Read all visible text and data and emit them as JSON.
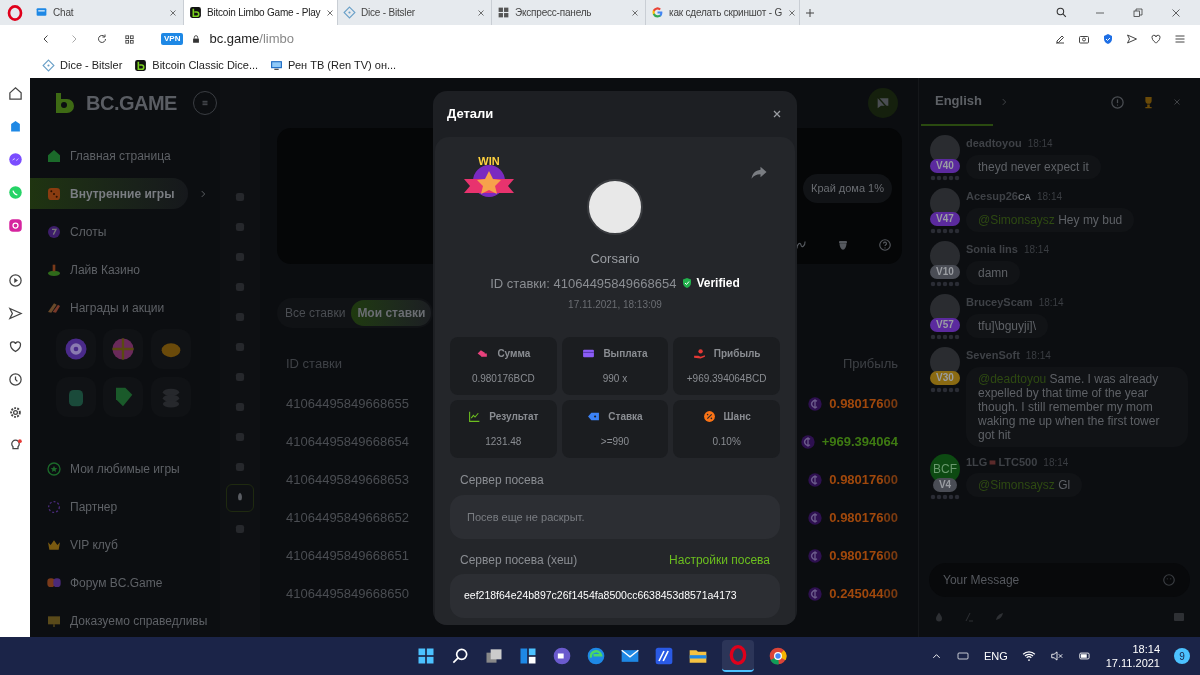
{
  "browser": {
    "tabs": [
      {
        "title": "Chat",
        "selected": false
      },
      {
        "title": "Bitcoin Limbo Game - Play",
        "selected": true
      },
      {
        "title": "Dice - Bitsler",
        "selected": false
      },
      {
        "title": "Экспресс-панель",
        "selected": false
      },
      {
        "title": "как сделать скриншот - G",
        "selected": false
      }
    ],
    "vpn": "VPN",
    "url_host": "bc.game",
    "url_path": "/limbo",
    "bookmarks": [
      {
        "title": "Dice - Bitsler"
      },
      {
        "title": "Bitcoin Classic Dice..."
      },
      {
        "title": "Рен ТВ (Ren TV) он..."
      }
    ]
  },
  "sidebar": {
    "logo": "BC.GAME",
    "sections": [
      {
        "items": [
          {
            "label": "Главная страница",
            "selected": false
          },
          {
            "label": "Внутренние игры",
            "selected": true
          },
          {
            "label": "Слоты",
            "selected": false
          },
          {
            "label": "Лайв Казино",
            "selected": false
          },
          {
            "label": "Награды и акции",
            "selected": false
          }
        ]
      },
      {
        "items": [
          {
            "label": "Мои любимые игры",
            "selected": false
          },
          {
            "label": "Партнер",
            "selected": false
          },
          {
            "label": "VIP клуб",
            "selected": false
          },
          {
            "label": "Форум BC.Game",
            "selected": false
          },
          {
            "label": "Доказуемо справедливы",
            "selected": false
          }
        ]
      }
    ]
  },
  "game": {
    "house_edge": "Край дома 1%"
  },
  "bets": {
    "tabs": [
      {
        "label": "Все ставки",
        "selected": false
      },
      {
        "label": "Мои ставки",
        "selected": true
      }
    ],
    "columns": [
      "ID ставки",
      "Прибыль"
    ],
    "rows": [
      {
        "id": "41064495849668655",
        "profit": "0.980176",
        "profit_tail": "00",
        "kind": "loss"
      },
      {
        "id": "41064495849668654",
        "profit": "+969.394064",
        "profit_tail": "",
        "kind": "win"
      },
      {
        "id": "41064495849668653",
        "profit": "0.980176",
        "profit_tail": "00",
        "kind": "loss"
      },
      {
        "id": "41064495849668652",
        "profit": "0.980176",
        "profit_tail": "00",
        "kind": "loss"
      },
      {
        "id": "41064495849668651",
        "profit": "0.980176",
        "profit_tail": "00",
        "kind": "loss"
      },
      {
        "id": "41064495849668650",
        "profit": "0.245044",
        "profit_tail": "00",
        "kind": "loss"
      }
    ]
  },
  "modal": {
    "title": "Детали",
    "badge": "WIN",
    "user": "Corsario",
    "bet_id": "ID ставки: 41064495849668654",
    "verified": "Verified",
    "date": "17.11.2021, 18:13:09",
    "stats": [
      {
        "label": "Сумма",
        "value": "0.980176BCD",
        "kind": "amount"
      },
      {
        "label": "Выплата",
        "value": "990 x",
        "kind": "payout"
      },
      {
        "label": "Прибыль",
        "value": "+969.394064BCD",
        "kind": "profit"
      },
      {
        "label": "Результат",
        "value": "1231.48",
        "kind": "result"
      },
      {
        "label": "Ставка",
        "value": ">=990",
        "kind": "target"
      },
      {
        "label": "Шанс",
        "value": "0.10%",
        "kind": "chance"
      }
    ],
    "seed_label": "Сервер посева",
    "seed_value": "Посев еще не раскрыт.",
    "hash_label": "Сервер посева (хеш)",
    "hash_link": "Настройки посева",
    "hash_value": "eef218f64e24b897c26f1454fa8500cc6638453d8571a4173"
  },
  "chat": {
    "tab": "English",
    "placeholder": "Your Message",
    "messages": [
      {
        "user": "deadtoyou",
        "time": "18:14",
        "level": "V40",
        "color": "#5b2a9e",
        "text": "theyd never expect it"
      },
      {
        "user": "Acesup26",
        "country": "CA",
        "time": "18:14",
        "level": "V47",
        "color": "#5b2a9e",
        "mention": "@Simonsaysz",
        "text": "Hey my bud"
      },
      {
        "user": "Sonia lins",
        "time": "18:14",
        "level": "V10",
        "color": "#4a4d55",
        "text": "damn"
      },
      {
        "user": "BruceyScam",
        "time": "18:14",
        "level": "V57",
        "color": "#5b2a9e",
        "text": "tfu]\\bguyji]\\"
      },
      {
        "user": "SevenSoft",
        "time": "18:14",
        "level": "V30",
        "color": "#8a6a12",
        "mention": "@deadtoyou",
        "text": "Same. I was already expelled by that time of the year though. I still remember my mom waking me up when the first tower got hit"
      },
      {
        "user": "1LG",
        "tag": "LTC500",
        "time": "18:14",
        "level": "V4",
        "color": "#4a4d55",
        "avatar_text": "BCF",
        "mention": "@Simonsaysz",
        "text": "Gl"
      }
    ]
  },
  "taskbar": {
    "language": "ENG",
    "time": "18:14",
    "date": "17.11.2021",
    "notifications": "9"
  }
}
